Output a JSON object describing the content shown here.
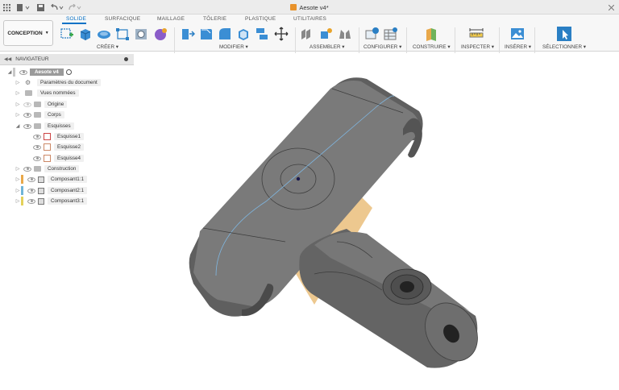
{
  "title_bar": {
    "document_title": "Aesote v4*"
  },
  "toolbar": {
    "workspace_label": "CONCEPTION",
    "tabs": [
      "SOLIDE",
      "SURFACIQUE",
      "MAILLAGE",
      "TÔLERIE",
      "PLASTIQUE",
      "UTILITAIRES"
    ],
    "active_tab": "SOLIDE",
    "groups": [
      "CRÉER ▾",
      "MODIFIER ▾",
      "ASSEMBLER ▾",
      "CONFIGURER ▾",
      "CONSTRUIRE ▾",
      "INSPECTER ▾",
      "INSÉRER ▾",
      "SÉLECTIONNER ▾"
    ]
  },
  "navigator": {
    "title": "NAVIGATEUR",
    "root": "Aesote v4",
    "items": [
      {
        "label": "Paramètres du document"
      },
      {
        "label": "Vues nommées"
      },
      {
        "label": "Origine"
      },
      {
        "label": "Corps"
      },
      {
        "label": "Esquisses"
      },
      {
        "label": "Esquisse1"
      },
      {
        "label": "Esquisse2"
      },
      {
        "label": "Esquisse4"
      },
      {
        "label": "Construction"
      },
      {
        "label": "Composant1:1"
      },
      {
        "label": "Composant2:1"
      },
      {
        "label": "Composant3:1"
      }
    ]
  },
  "colors": {
    "accent": "#0a72c6",
    "model_body": "#6b6b6b",
    "sketch_line": "#7fb6e0",
    "construction_plane": "#e7b56a",
    "component1_marker": "#e9a84a",
    "component2_marker": "#6fb4d8",
    "component3_marker": "#e4d15a"
  }
}
